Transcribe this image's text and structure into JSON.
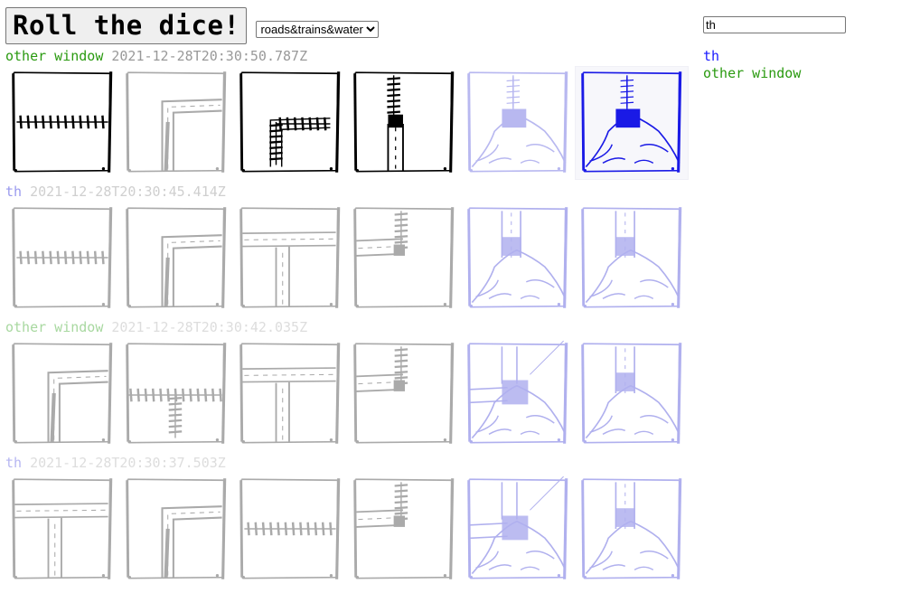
{
  "toolbar": {
    "roll_label": "Roll the dice!",
    "mode_select": {
      "selected": "roads&trains&water",
      "options": [
        "roads&trains&water"
      ]
    }
  },
  "search": {
    "value": "th"
  },
  "sidebar": {
    "items": [
      {
        "label": "th",
        "color": "#1a1aff"
      },
      {
        "label": "other window",
        "color": "#2a9a10"
      }
    ]
  },
  "rows": [
    {
      "name": "other window",
      "timestamp": "2021-12-28T20:30:50.787Z",
      "name_color": "#2a9a10",
      "ts_color": "#999999",
      "tiles": [
        {
          "kind": "road-h",
          "color": "#000000"
        },
        {
          "kind": "road-corner",
          "color": "#aaaaaa"
        },
        {
          "kind": "rail-corner",
          "color": "#000000"
        },
        {
          "kind": "rail-road-v",
          "color": "#000000"
        },
        {
          "kind": "water",
          "color": "#b8b8f0"
        },
        {
          "kind": "water",
          "color": "#1a1ae6",
          "selected": true
        }
      ]
    },
    {
      "name": "th",
      "timestamp": "2021-12-28T20:30:45.414Z",
      "name_color": "#9a9aee",
      "ts_color": "#cfcfcf",
      "tiles": [
        {
          "kind": "road-h",
          "color": "#aaaaaa"
        },
        {
          "kind": "road-corner",
          "color": "#aaaaaa"
        },
        {
          "kind": "road-t",
          "color": "#aaaaaa"
        },
        {
          "kind": "road-rail-corner",
          "color": "#aaaaaa"
        },
        {
          "kind": "water-road",
          "color": "#b0b0ee"
        },
        {
          "kind": "water-road",
          "color": "#b0b0ee"
        }
      ]
    },
    {
      "name": "other window",
      "timestamp": "2021-12-28T20:30:42.035Z",
      "name_color": "#a8d8a0",
      "ts_color": "#dddddd",
      "tiles": [
        {
          "kind": "road-corner",
          "color": "#aaaaaa"
        },
        {
          "kind": "rail-t",
          "color": "#aaaaaa"
        },
        {
          "kind": "road-t",
          "color": "#aaaaaa"
        },
        {
          "kind": "road-rail-corner",
          "color": "#aaaaaa"
        },
        {
          "kind": "water-cross",
          "color": "#b0b0ee"
        },
        {
          "kind": "water-road",
          "color": "#b0b0ee"
        }
      ]
    },
    {
      "name": "th",
      "timestamp": "2021-12-28T20:30:37.503Z",
      "name_color": "#b6b6f2",
      "ts_color": "#dddddd",
      "tiles": [
        {
          "kind": "road-t",
          "color": "#aaaaaa"
        },
        {
          "kind": "road-corner",
          "color": "#aaaaaa"
        },
        {
          "kind": "road-h",
          "color": "#aaaaaa"
        },
        {
          "kind": "road-rail-corner",
          "color": "#aaaaaa"
        },
        {
          "kind": "water-cross",
          "color": "#b0b0ee"
        },
        {
          "kind": "water-road",
          "color": "#b0b0ee"
        }
      ]
    }
  ]
}
